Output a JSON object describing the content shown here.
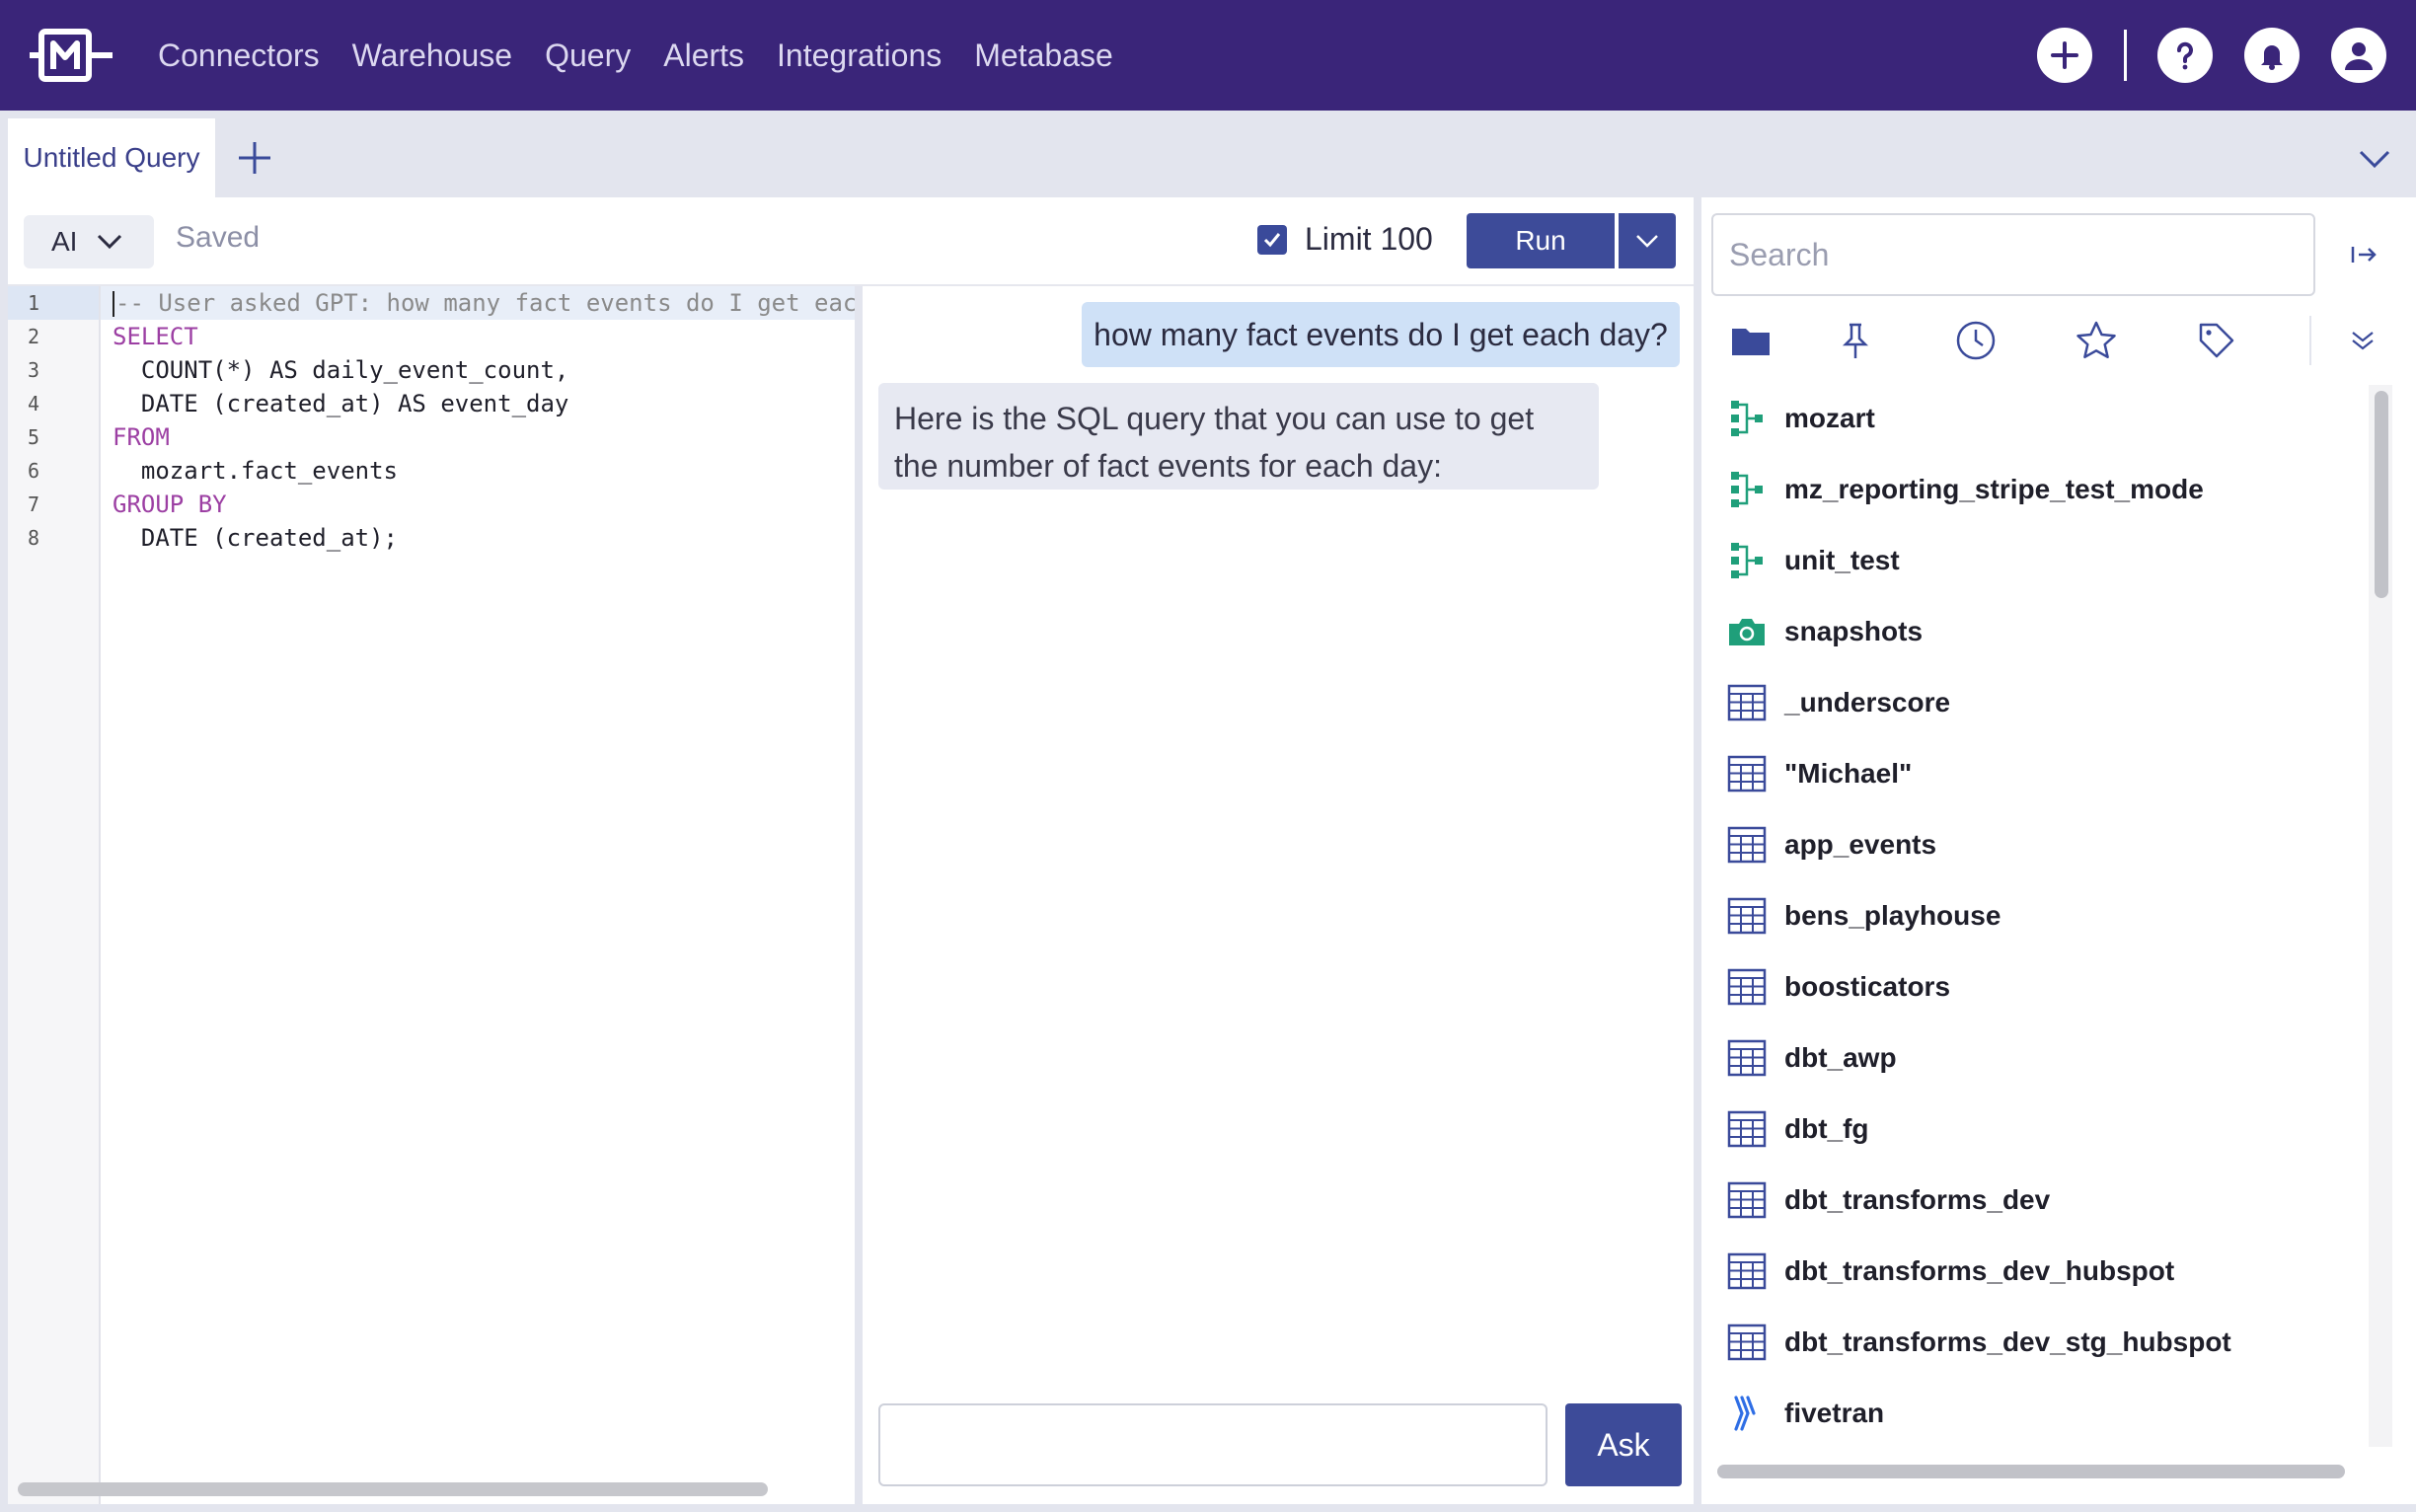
{
  "nav": {
    "items": [
      {
        "label": "Connectors"
      },
      {
        "label": "Warehouse"
      },
      {
        "label": "Query"
      },
      {
        "label": "Alerts"
      },
      {
        "label": "Integrations"
      },
      {
        "label": "Metabase"
      }
    ],
    "icons": [
      "plus-icon",
      "help-icon",
      "bell-icon",
      "user-icon"
    ]
  },
  "tabs": {
    "active_label": "Untitled Query"
  },
  "toolbar": {
    "mode_label": "AI",
    "status_label": "Saved",
    "limit_label": "Limit 100",
    "limit_checked": true,
    "run_label": "Run"
  },
  "editor": {
    "line_numbers": [
      "1",
      "2",
      "3",
      "4",
      "5",
      "6",
      "7",
      "8"
    ],
    "lines": [
      "-- User asked GPT: how many fact events do I get eac",
      "SELECT",
      "  COUNT(*) AS daily_event_count,",
      "  DATE (created_at) AS event_day",
      "FROM",
      "  mozart.fact_events",
      "GROUP BY",
      "  DATE (created_at);"
    ]
  },
  "chat": {
    "user_message": "how many fact events do I get each day?",
    "ai_message": "Here is the SQL query that you can use to get the number of fact events for each day:",
    "input_value": "",
    "ask_label": "Ask"
  },
  "sidebar": {
    "search_placeholder": "Search",
    "filter_icons": [
      "folder-icon",
      "pin-icon",
      "clock-icon",
      "star-icon",
      "tag-icon"
    ],
    "items": [
      {
        "label": "mozart",
        "type": "schema"
      },
      {
        "label": "mz_reporting_stripe_test_mode",
        "type": "schema"
      },
      {
        "label": "unit_test",
        "type": "schema"
      },
      {
        "label": "snapshots",
        "type": "snapshot"
      },
      {
        "label": "_underscore",
        "type": "table"
      },
      {
        "label": "\"Michael\"",
        "type": "table"
      },
      {
        "label": "app_events",
        "type": "table"
      },
      {
        "label": "bens_playhouse",
        "type": "table"
      },
      {
        "label": "boosticators",
        "type": "table"
      },
      {
        "label": "dbt_awp",
        "type": "table"
      },
      {
        "label": "dbt_fg",
        "type": "table"
      },
      {
        "label": "dbt_transforms_dev",
        "type": "table"
      },
      {
        "label": "dbt_transforms_dev_hubspot",
        "type": "table"
      },
      {
        "label": "dbt_transforms_dev_stg_hubspot",
        "type": "table"
      },
      {
        "label": "fivetran",
        "type": "fivetran"
      }
    ]
  },
  "colors": {
    "nav_bg": "#3a2579",
    "accent": "#3d4b99",
    "schema_icon": "#1f9f7a",
    "table_icon": "#3a4a9a",
    "fivetran_icon": "#2f6ee5"
  }
}
